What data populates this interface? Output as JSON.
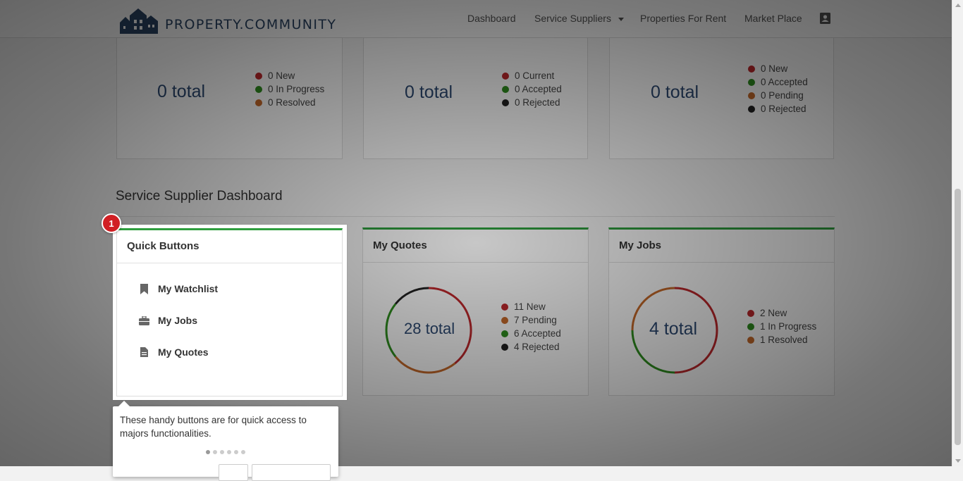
{
  "navbar": {
    "brand": "PROPERTY.COMMUNITY",
    "items": [
      "Dashboard",
      "Service Suppliers",
      "Properties For Rent",
      "Market Place"
    ]
  },
  "top_cards": [
    {
      "total": "0 total",
      "legend": [
        "0 New",
        "0 In Progress",
        "0 Resolved"
      ]
    },
    {
      "total": "0 total",
      "legend": [
        "0 Current",
        "0 Accepted",
        "0 Rejected"
      ]
    },
    {
      "total": "0 total",
      "legend": [
        "0 New",
        "0 Accepted",
        "0 Pending",
        "0 Rejected"
      ]
    }
  ],
  "section_title": "Service Supplier Dashboard",
  "quick_buttons": {
    "title": "Quick Buttons",
    "items": [
      "My Watchlist",
      "My Jobs",
      "My Quotes"
    ]
  },
  "my_quotes": {
    "title": "My Quotes",
    "total": "28 total",
    "legend": [
      "11 New",
      "7 Pending",
      "6 Accepted",
      "4 Rejected"
    ],
    "segments": [
      11,
      7,
      6,
      4
    ]
  },
  "my_jobs": {
    "title": "My Jobs",
    "total": "4 total",
    "legend": [
      "2 New",
      "1 In Progress",
      "1 Resolved"
    ],
    "segments": [
      2,
      1,
      1
    ]
  },
  "tour": {
    "step": "1",
    "text": "These handy buttons are for quick access to majors functionalities.",
    "steps_total": 6,
    "current_step": 1
  },
  "colors": {
    "new": "#c0282c",
    "pending": "#c76a2a",
    "accepted": "#2f8f1f",
    "rejected": "#222222",
    "accent": "#2e9e3e",
    "brand": "#2b4566"
  }
}
